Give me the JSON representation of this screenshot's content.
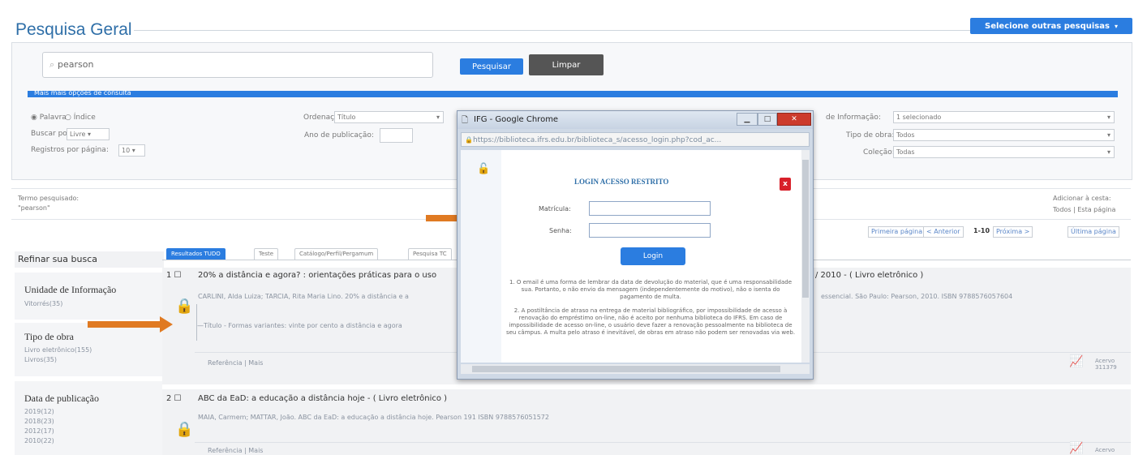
{
  "header": {
    "title": "Pesquisa Geral",
    "select_other_label": "Selecione outras pesquisas"
  },
  "search": {
    "query": "pearson",
    "search_button": "Pesquisar",
    "clear_button": "Limpar",
    "more_options": "Mais mais opções de consulta"
  },
  "filters": {
    "palavra": "Palavra",
    "indice": "Índice",
    "buscar_por_label": "Buscar por:",
    "buscar_por_value": "Livre",
    "registros_label": "Registros por página:",
    "registros_value": "10",
    "ordenacao_label": "Ordenação:",
    "ordenacao_value": "Título",
    "ano_label": "Ano de publicação:",
    "unidade_label": "de Informação:",
    "unidade_value": "1 selecionado",
    "tipo_obra_label": "Tipo de obra:",
    "tipo_obra_value": "Todos",
    "colecao_label": "Coleção:",
    "colecao_value": "Todas"
  },
  "terms": {
    "label": "Termo pesquisado:",
    "value": "\"pearson\"",
    "adicionar_label": "Adicionar à cesta:",
    "adicionar_links": "Todos | Esta página"
  },
  "pagination": {
    "first": "Primeira página",
    "prev": "< Anterior",
    "range": "1-10",
    "next": "Próxima >",
    "last": "Última página"
  },
  "sidebar": {
    "heading": "Refinar sua busca",
    "facets": [
      {
        "title": "Unidade de Informação",
        "items": [
          "Vitorrés(35)"
        ]
      },
      {
        "title": "Tipo de obra",
        "items": [
          "Livro eletrônico(155)",
          "Livros(35)"
        ]
      },
      {
        "title": "Data de publicação",
        "items": [
          "2019(12)",
          "2018(23)",
          "2012(17)",
          "2010(22)"
        ]
      }
    ]
  },
  "tabs": [
    "Resultados TUDO",
    "Teste",
    "Catálogo/Perfil/Pergamum",
    "Pesquisa TC"
  ],
  "results": [
    {
      "title": "20% a distância e agora? : orientações práticas para o uso",
      "title_suffix": "/ 2010 - ( Livro eletrônico )",
      "meta": "CARLINI, Alda Luiza; TARCIA, Rita Maria Lino. 20% a distância e a",
      "meta_suffix": "essencial. São Paulo: Pearson, 2010. ISBN 9788576057604",
      "subject": "—Título - Formas variantes: vinte por cento a distância e agora",
      "actions": "Referência | Mais",
      "badge": "Acervo 311379"
    },
    {
      "title": "ABC da EaD: a educação a distância hoje - ( Livro eletrônico )",
      "meta": "MAIA, Carmem; MATTAR, João. ABC da EaD: a educação a distância hoje. Pearson 191 ISBN 9788576051572",
      "actions": "Referência | Mais",
      "badge": "Acervo"
    }
  ],
  "popup": {
    "window_title": "IFG - Google Chrome",
    "url": "https://biblioteca.ifrs.edu.br/biblioteca_s/acesso_login.php?cod_ac...",
    "heading": "LOGIN ACESSO RESTRITO",
    "matricula_label": "Matrícula:",
    "senha_label": "Senha:",
    "login_button": "Login",
    "close_x": "x",
    "paragraph1": "1. O email é uma forma de lembrar da data de devolução do material, que é uma responsabilidade sua. Portanto, o não envio da mensagem (independentemente do motivo), não o isenta do pagamento de multa.",
    "paragraph2": "2. A postiltância de atraso na entrega de material bibliográfico, por impossibilidade de acesso à renovação do empréstimo on-line, não é aceito por nenhuma biblioteca do IFRS. Em caso de impossibilidade de acesso on-line, o usuário deve fazer a renovação pessoalmente na biblioteca de seu câmpus. A multa pelo atraso é inevitável, de obras em atraso não podem ser renovadas via web."
  }
}
